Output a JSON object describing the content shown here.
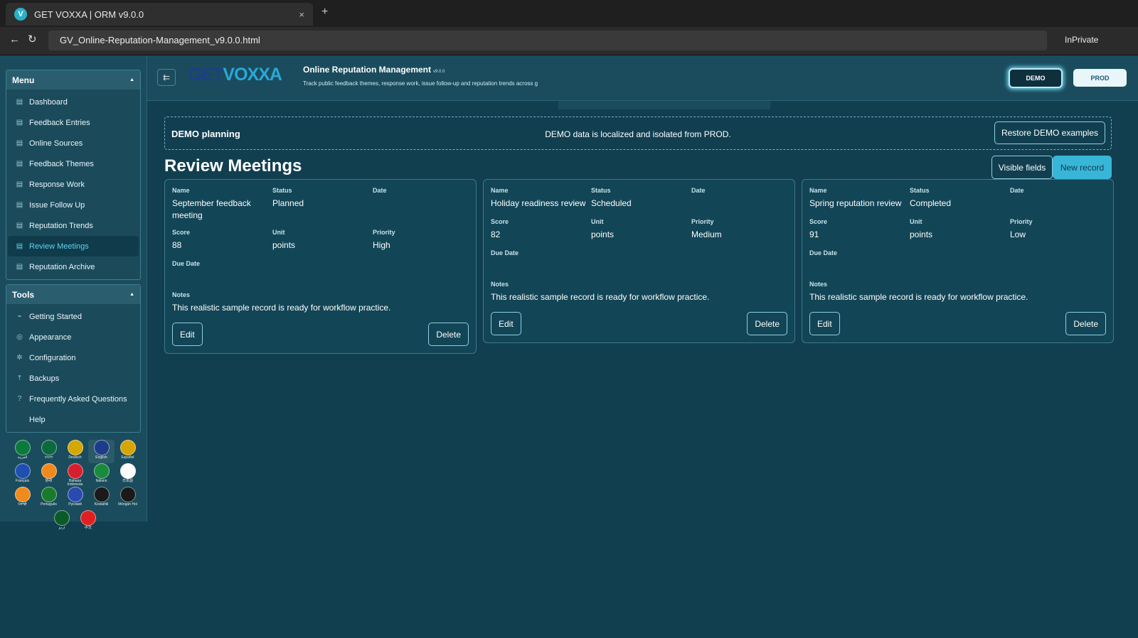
{
  "browser": {
    "tab_title": "GET VOXXA | ORM v9.0.0",
    "favicon_letter": "V",
    "close_glyph": "×",
    "new_tab_glyph": "+",
    "back_glyph": "←",
    "reload_glyph": "↻",
    "url": "GV_Online-Reputation-Management_v9.0.0.html",
    "inprivate": "InPrivate"
  },
  "sidebar": {
    "menu_title": "Menu",
    "menu_items": [
      {
        "label": "Dashboard",
        "icon": "document-icon"
      },
      {
        "label": "Feedback Entries",
        "icon": "document-icon"
      },
      {
        "label": "Online Sources",
        "icon": "document-icon"
      },
      {
        "label": "Feedback Themes",
        "icon": "document-icon"
      },
      {
        "label": "Response Work",
        "icon": "document-icon"
      },
      {
        "label": "Issue Follow Up",
        "icon": "document-icon"
      },
      {
        "label": "Reputation Trends",
        "icon": "document-icon"
      },
      {
        "label": "Review Meetings",
        "icon": "document-icon",
        "active": true
      },
      {
        "label": "Reputation Archive",
        "icon": "document-icon"
      }
    ],
    "tools_title": "Tools",
    "tools_items": [
      {
        "label": "Getting Started",
        "icon": "rocket-icon"
      },
      {
        "label": "Appearance",
        "icon": "palette-icon"
      },
      {
        "label": "Configuration",
        "icon": "gear-icon"
      },
      {
        "label": "Backups",
        "icon": "upload-icon"
      },
      {
        "label": "Frequently Asked Questions",
        "icon": "question-icon"
      },
      {
        "label": "Help",
        "icon": ""
      }
    ],
    "languages": [
      {
        "label": "العربية",
        "color": "#0a7a3a"
      },
      {
        "label": "বাংলা",
        "color": "#0a6a3f"
      },
      {
        "label": "Deutsch",
        "color": "#d4a800"
      },
      {
        "label": "English",
        "color": "#1e3a8a"
      },
      {
        "label": "Español",
        "color": "#d8a400"
      },
      {
        "label": "Français",
        "color": "#1f4fb0"
      },
      {
        "label": "हिन्दी",
        "color": "#f08a1c"
      },
      {
        "label": "Bahasa Indonesia",
        "color": "#d81e2c"
      },
      {
        "label": "Italiano",
        "color": "#1a8a3c"
      },
      {
        "label": "日本語",
        "color": "#ffffff"
      },
      {
        "label": "ਪੰਜਾਬੀ",
        "color": "#f08a1c"
      },
      {
        "label": "Português",
        "color": "#1a7a2c"
      },
      {
        "label": "Русский",
        "color": "#2a4ab0"
      },
      {
        "label": "Kiswahili",
        "color": "#1a1a1a"
      },
      {
        "label": "tlhIngan Hol",
        "color": "#1a1a1a"
      },
      {
        "label": "اردو",
        "color": "#0a5a2a"
      },
      {
        "label": "中文",
        "color": "#e02020"
      }
    ]
  },
  "header": {
    "logo_get": "GET",
    "logo_voxxa": "VOXXA",
    "menu_toggle_glyph": "⇇",
    "title": "Online Reputation Management",
    "version": "v9.0.0",
    "subtitle": "Track public feedback themes, response work, issue follow-up and reputation trends across g",
    "demo_label": "DEMO",
    "prod_label": "PROD"
  },
  "banner": {
    "title": "DEMO planning",
    "message": "DEMO data is localized and isolated from PROD.",
    "restore_label": "Restore DEMO examples"
  },
  "main": {
    "title": "Review Meetings",
    "visible_fields_label": "Visible fields",
    "new_record_label": "New record"
  },
  "field_labels": {
    "name": "Name",
    "status": "Status",
    "date": "Date",
    "score": "Score",
    "unit": "Unit",
    "priority": "Priority",
    "due_date": "Due Date",
    "notes": "Notes"
  },
  "records": [
    {
      "name": "September feedback meeting",
      "status": "Planned",
      "date": "",
      "score": "88",
      "unit": "points",
      "priority": "High",
      "due_date": "",
      "notes": "This realistic sample record is ready for workflow practice.",
      "edit_label": "Edit",
      "delete_label": "Delete"
    },
    {
      "name": "Holiday readiness review",
      "status": "Scheduled",
      "date": "",
      "score": "82",
      "unit": "points",
      "priority": "Medium",
      "due_date": "",
      "notes": "This realistic sample record is ready for workflow practice.",
      "edit_label": "Edit",
      "delete_label": "Delete"
    },
    {
      "name": "Spring reputation review",
      "status": "Completed",
      "date": "",
      "score": "91",
      "unit": "points",
      "priority": "Low",
      "due_date": "",
      "notes": "This realistic sample record is ready for workflow practice.",
      "edit_label": "Edit",
      "delete_label": "Delete"
    }
  ],
  "colors": {
    "background": "#113f50",
    "accent": "#38b6d8",
    "active_text": "#5fd2ef"
  }
}
